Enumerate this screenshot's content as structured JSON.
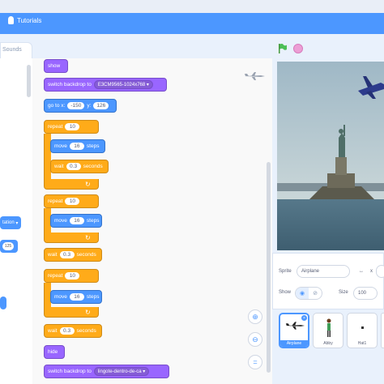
{
  "menu": {
    "tutorials_label": "Tutorials"
  },
  "palette": {
    "tab_label": "Sounds",
    "dd_label": "tation",
    "num_value": "125"
  },
  "script": {
    "show": "show",
    "switch1": {
      "label": "switch backdrop to",
      "value": "E3CM9565-1024x768"
    },
    "goto": {
      "label1": "go to x:",
      "x": "-150",
      "label2": "y:",
      "y": "126"
    },
    "repeat1": {
      "label": "repeat",
      "count": "10"
    },
    "move1": {
      "label1": "move",
      "steps": "16",
      "label2": "steps"
    },
    "wait1": {
      "label1": "wait",
      "secs": "0.3",
      "label2": "seconds"
    },
    "repeat2": {
      "label": "repeat",
      "count": "10"
    },
    "move2": {
      "label1": "move",
      "steps": "16",
      "label2": "steps"
    },
    "wait2": {
      "label1": "wait",
      "secs": "0.3",
      "label2": "seconds"
    },
    "repeat3": {
      "label": "repeat",
      "count": "10"
    },
    "move3": {
      "label1": "move",
      "steps": "16",
      "label2": "steps"
    },
    "wait3": {
      "label1": "wait",
      "secs": "0.3",
      "label2": "seconds"
    },
    "hide": "hide",
    "switch2": {
      "label": "switch backdrop to",
      "value": "lingote-dentro-de-ca"
    }
  },
  "sprite_info": {
    "sprite_label": "Sprite",
    "sprite_name": "Airplane",
    "x_label": "x",
    "show_label": "Show",
    "size_label": "Size",
    "size_value": "100"
  },
  "sprites": [
    {
      "name": "Airplane",
      "selected": true
    },
    {
      "name": "Abby",
      "selected": false
    },
    {
      "name": "Hat1",
      "selected": false
    }
  ],
  "colors": {
    "menu_bar": "#4c97ff",
    "looks": "#9966ff",
    "motion": "#4c97ff",
    "control": "#ffab19"
  },
  "icons": {
    "tutorials": "lightbulb-icon",
    "green_flag": "green-flag-icon",
    "stop": "stop-icon",
    "zoom_in": "zoom-in-icon",
    "zoom_out": "zoom-out-icon",
    "zoom_reset": "zoom-reset-icon"
  }
}
